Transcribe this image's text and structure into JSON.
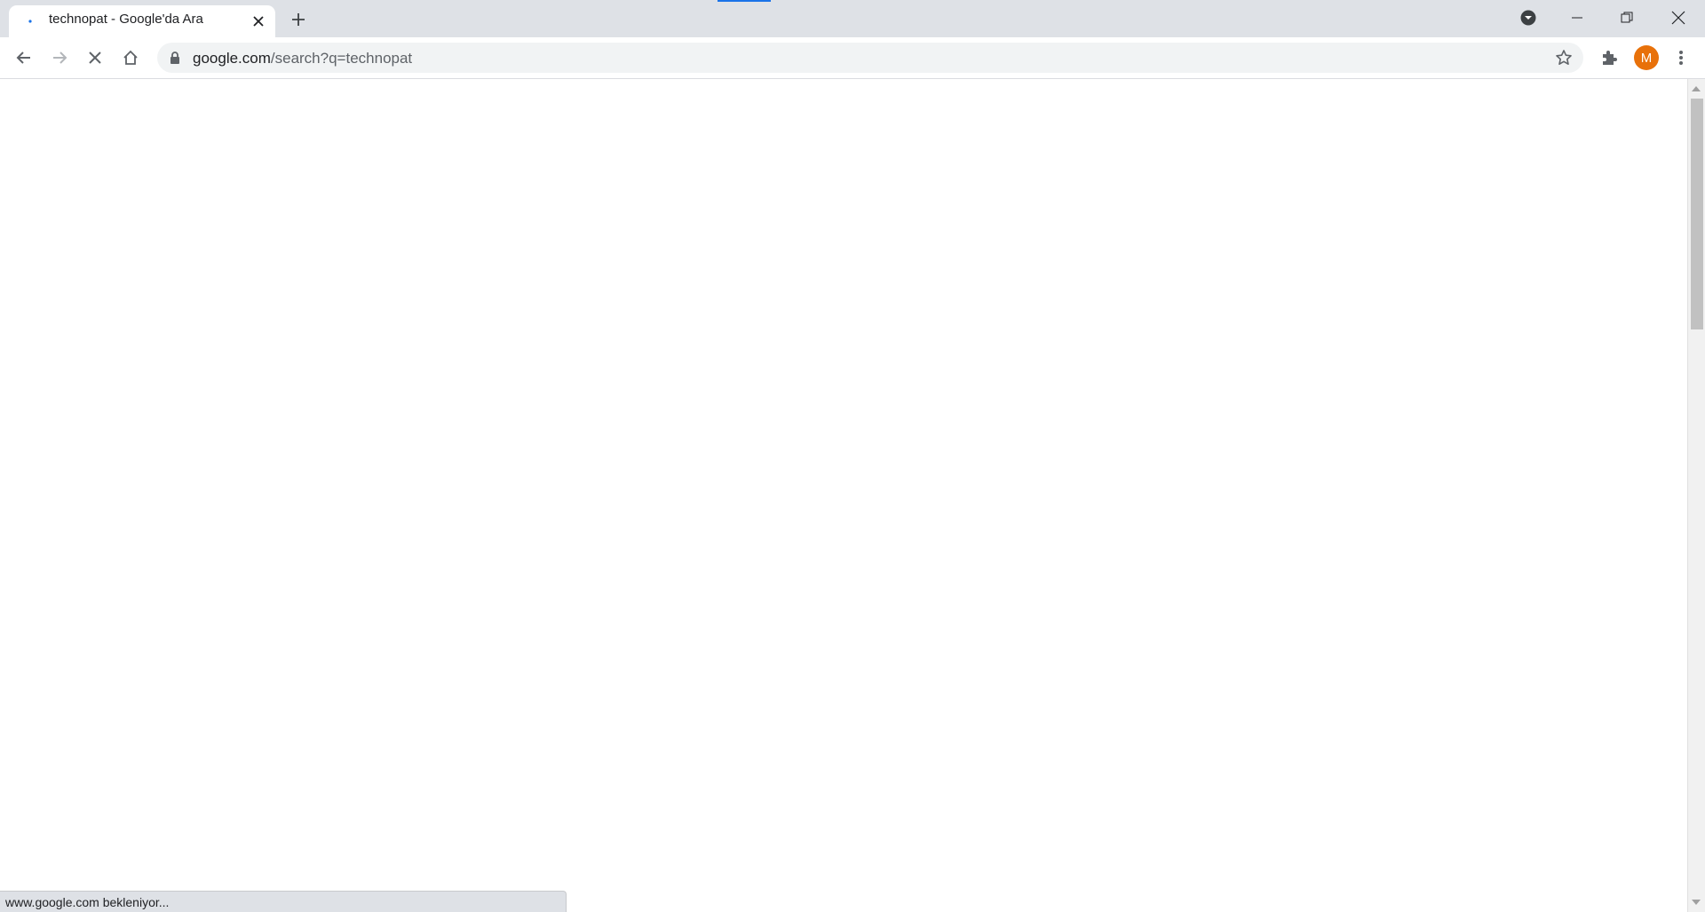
{
  "browser": {
    "tab": {
      "title": "technopat - Google'da Ara",
      "favicon": "google-loading-favicon"
    },
    "new_tab_icon": "plus-icon",
    "window_controls": [
      "tab-search-icon",
      "minimize-icon",
      "restore-icon",
      "close-icon"
    ]
  },
  "toolbar": {
    "url_host": "google.com",
    "url_rest": "/search?q=technopat",
    "nav_icons": [
      "back-arrow-icon",
      "forward-arrow-icon",
      "stop-loading-icon",
      "home-icon"
    ],
    "profile_initial": "M"
  },
  "status": {
    "text": "www.google.com bekleniyor..."
  },
  "colors": {
    "tabstrip": "#dee1e6",
    "accent": "#1a73e8",
    "avatar": "#e8710a"
  }
}
